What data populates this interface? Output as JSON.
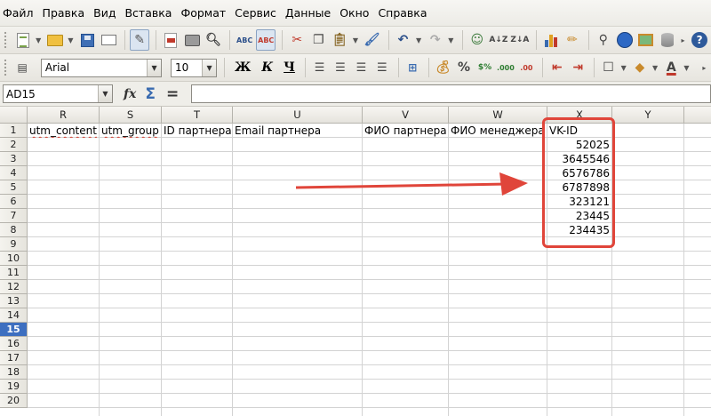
{
  "menu": [
    "Файл",
    "Правка",
    "Вид",
    "Вставка",
    "Формат",
    "Сервис",
    "Данные",
    "Окно",
    "Справка"
  ],
  "format_bar": {
    "font_name": "Arial",
    "font_size": "10",
    "bold": "Ж",
    "italic": "К",
    "underline": "Ч"
  },
  "formula_bar": {
    "name_box": "AD15",
    "fx": "fx",
    "sigma": "Σ",
    "equals": "=",
    "formula": ""
  },
  "columns": [
    "R",
    "S",
    "T",
    "U",
    "V",
    "W",
    "X",
    "Y"
  ],
  "rows": [
    "1",
    "2",
    "3",
    "4",
    "5",
    "6",
    "7",
    "8",
    "9",
    "10",
    "11",
    "12",
    "13",
    "14",
    "15",
    "16",
    "17",
    "18",
    "19",
    "20"
  ],
  "selected_row": "15",
  "header_cells": {
    "R": "utm_content",
    "S": "utm_group",
    "T": "ID партнера",
    "U": "Email партнера",
    "V": "ФИО партнера",
    "W": "ФИО менеджера",
    "X": "VK-ID"
  },
  "vk_ids": [
    "52025",
    "3645546",
    "6576786",
    "6787898",
    "323121",
    "23445",
    "234435"
  ],
  "annotation_color": "#e0453a",
  "selection_color": "#3d6fc0"
}
